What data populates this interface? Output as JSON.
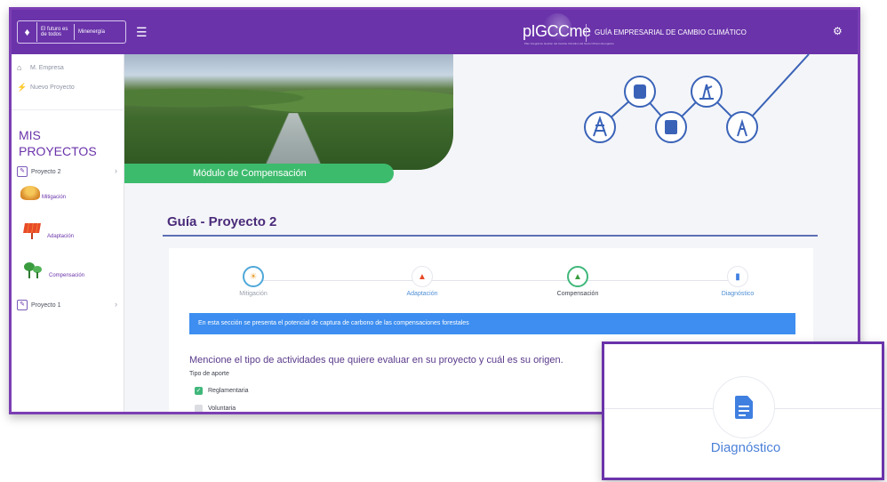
{
  "header": {
    "logo_text_1": "El futuro es de todos",
    "logo_text_2": "Minenergía",
    "brand": "pIGCCme",
    "brand_sub": "Plan Integral de Gestión del Cambio Climático del Sector Minero Energético",
    "guide_title": "GUÍA EMPRESARIAL DE CAMBIO CLIMÁTICO",
    "menu_icon": "hamburger-icon",
    "settings_icon": "gear-icon"
  },
  "sidebar": {
    "links": [
      {
        "label": "M. Empresa",
        "icon": "home-icon"
      },
      {
        "label": "Nuevo Proyecto",
        "icon": "plug-icon"
      }
    ],
    "section_title": "MIS PROYECTOS",
    "projects": [
      {
        "label": "Proyecto 2",
        "icon": "edit-icon"
      },
      {
        "label": "Proyecto 1",
        "icon": "edit-icon"
      }
    ],
    "sub_items": [
      {
        "label": "Mitigación",
        "icon": "mitigation-icon"
      },
      {
        "label": "Adaptación",
        "icon": "solar-panel-icon"
      },
      {
        "label": "Compensación",
        "icon": "trees-icon"
      }
    ]
  },
  "hero": {
    "module_label": "Módulo de Compensación"
  },
  "main": {
    "title": "Guía - Proyecto 2",
    "steps": [
      {
        "label": "Mitigación",
        "icon": "mitigation-icon"
      },
      {
        "label": "Adaptación",
        "icon": "solar-panel-icon"
      },
      {
        "label": "Compensación",
        "icon": "trees-icon"
      },
      {
        "label": "Diagnóstico",
        "icon": "document-icon"
      }
    ],
    "info_banner": "En esta sección se presenta el potencial de captura de carbono de las compensaciones forestales",
    "question": "Mencione el tipo de actividades que quiere evaluar en su proyecto y cuál es su origen.",
    "tipo_label": "Tipo de aporte",
    "options": [
      {
        "label": "Reglamentaria",
        "checked": true
      },
      {
        "label": "Voluntaria",
        "checked": false
      }
    ]
  },
  "zoom": {
    "label": "Diagnóstico",
    "icon": "document-icon"
  },
  "colors": {
    "topbar": "#6a33aa",
    "accent_green": "#3dbb6d",
    "banner_blue": "#3d8ef0",
    "title_purple": "#4a2b7a"
  }
}
